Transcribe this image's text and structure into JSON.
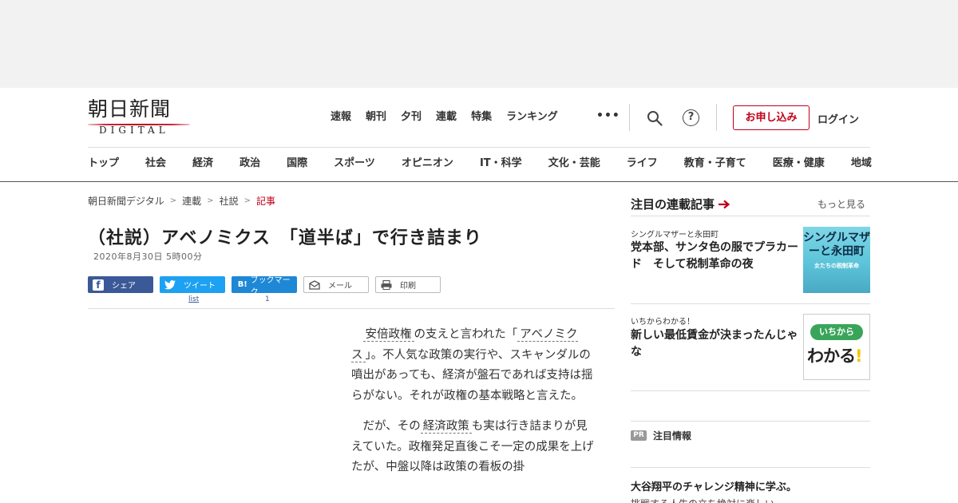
{
  "header": {
    "logo_title": "朝日新聞",
    "logo_sub": "DIGITAL",
    "nav": [
      "速報",
      "朝刊",
      "夕刊",
      "連載",
      "特集",
      "ランキング"
    ],
    "more_label": "•••",
    "help_label": "?",
    "subscribe_label": "お申し込み",
    "login_label": "ログイン",
    "categories": [
      "トップ",
      "社会",
      "経済",
      "政治",
      "国際",
      "スポーツ",
      "オピニオン",
      "IT・科学",
      "文化・芸能",
      "ライフ",
      "教育・子育て",
      "医療・健康",
      "地域"
    ]
  },
  "breadcrumb": {
    "items": [
      "朝日新聞デジタル",
      "連載",
      "社説"
    ],
    "current": "記事",
    "separator": ">"
  },
  "article": {
    "title": "（社説）アベノミクス　「道半ば」で行き詰まり",
    "date": "2020年8月30日 5時00分",
    "p1_pre": "安倍政権",
    "p1_mid1": "の支えと言われた「",
    "p1_kw": "アベノミクス",
    "p1_rest": "」。不人気な政策の実行や、スキャンダルの噴出があっても、経済が盤石であれば支持は揺らがない。それが政権の基本戦略と言えた。",
    "p2_pre": "だが、その",
    "p2_kw": "経済政策",
    "p2_rest": "も実は行き詰まりが見えていた。政権発足直後こそ一定の成果を上げたが、中盤以降は政策の看板の掛"
  },
  "share": {
    "facebook": "シェア",
    "twitter": "ツイート",
    "hatena_icon": "B!",
    "hatena": "ブックマーク",
    "mail": "メール",
    "print": "印刷",
    "twitter_count": "list",
    "hatena_count": "1"
  },
  "sidebar": {
    "heading": "注目の連載記事",
    "more": "もっと見る",
    "items": [
      {
        "category": "シングルマザーと永田町",
        "title": "党本部、サンタ色の服でプラカード　そして税制革命の夜",
        "thumb_title": "シングルマザーと永田町",
        "thumb_sub": "女たちの税制革命"
      },
      {
        "category": "いちからわかる！",
        "title": "新しい最低賃金が決まったんじゃな",
        "thumb_pill": "いちから",
        "thumb_big": "わかる",
        "thumb_bang": "!"
      }
    ],
    "pr_badge": "PR",
    "pr_label": "注目情報",
    "pr_title": "大谷翔平のチャレンジ精神に学ぶ。",
    "pr_sub": "挑戦する人生の立ち絶対に楽しい"
  },
  "colors": {
    "accent": "#c0001b",
    "facebook": "#3b5998",
    "twitter": "#1da1f2",
    "hatena": "#1e88d6"
  }
}
